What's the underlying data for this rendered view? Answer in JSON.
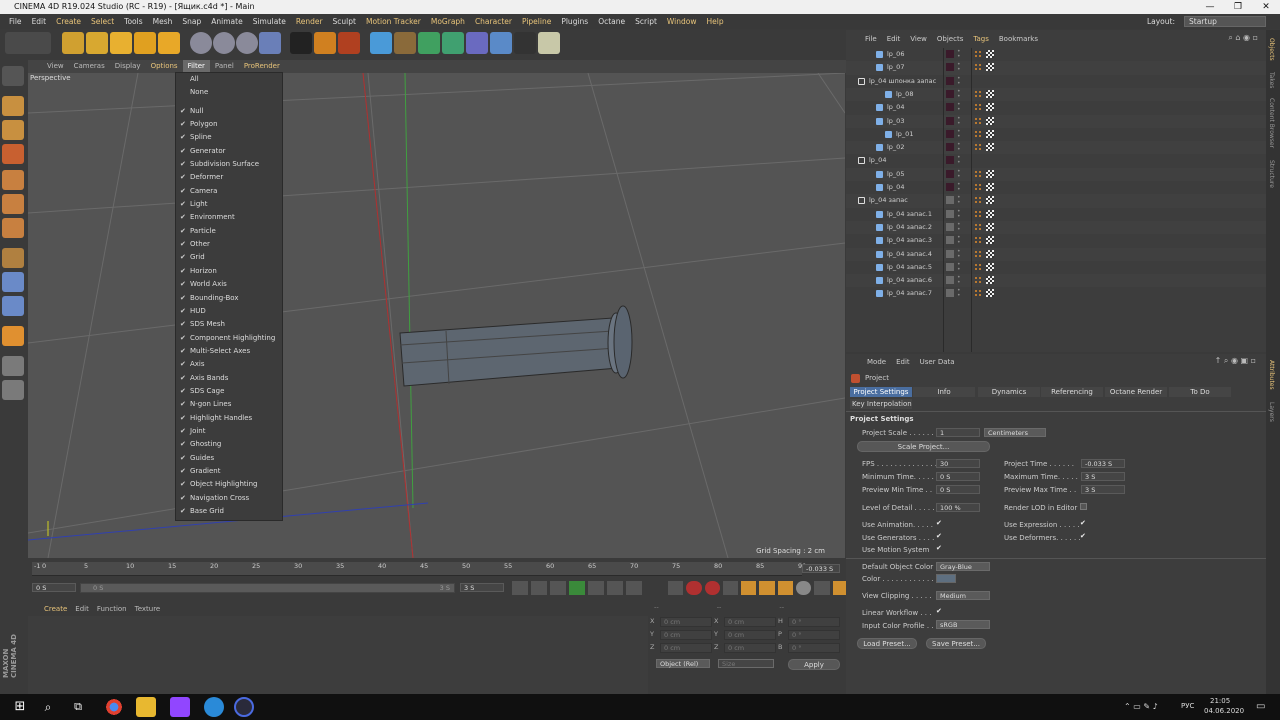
{
  "window": {
    "title": "CINEMA 4D R19.024 Studio (RC - R19) - [Ящик.c4d *] - Main",
    "min": "—",
    "max": "❐",
    "close": "✕"
  },
  "menubar": [
    "File",
    "Edit",
    "Create",
    "Select",
    "Tools",
    "Mesh",
    "Snap",
    "Animate",
    "Simulate",
    "Render",
    "Sculpt",
    "Motion Tracker",
    "MoGraph",
    "Character",
    "Pipeline",
    "Plugins",
    "Octane",
    "Script",
    "Window",
    "Help"
  ],
  "layout": {
    "label": "Layout:",
    "value": "Startup"
  },
  "viewport": {
    "menu": [
      "View",
      "Cameras",
      "Display",
      "Options",
      "Filter",
      "Panel",
      "ProRender"
    ],
    "label": "Perspective",
    "grid_spacing": "Grid Spacing : 2 cm"
  },
  "filter_menu": {
    "top": [
      "All",
      "None"
    ],
    "items": [
      "Null",
      "Polygon",
      "Spline",
      "Generator",
      "Subdivision Surface",
      "Deformer",
      "Camera",
      "Light",
      "Environment",
      "Particle",
      "Other",
      "Grid",
      "Horizon",
      "World Axis",
      "Bounding-Box",
      "HUD",
      "SDS Mesh",
      "Component Highlighting",
      "Multi-Select Axes",
      "Axis",
      "Axis Bands",
      "SDS Cage",
      "N-gon Lines",
      "Highlight Handles",
      "Joint",
      "Ghosting",
      "Guides",
      "Gradient",
      "Object Highlighting",
      "Navigation Cross",
      "Base Grid"
    ]
  },
  "timeline": {
    "ticks": [
      "-1",
      "0",
      "5",
      "10",
      "15",
      "20",
      "25",
      "30",
      "35",
      "40",
      "45",
      "50",
      "55",
      "60",
      "65",
      "70",
      "75",
      "80",
      "85",
      "90"
    ],
    "current": "-0.033 S",
    "start": "0 S",
    "slider_left": "0 S",
    "slider_right": "3 S",
    "end": "3 S"
  },
  "material_menu": [
    "Create",
    "Edit",
    "Function",
    "Texture"
  ],
  "coords": {
    "headers": [
      "--",
      "--",
      "--"
    ],
    "rows": [
      {
        "a": "X",
        "av": "0 cm",
        "b": "X",
        "bv": "0 cm",
        "c": "H",
        "cv": "0 °"
      },
      {
        "a": "Y",
        "av": "0 cm",
        "b": "Y",
        "bv": "0 cm",
        "c": "P",
        "cv": "0 °"
      },
      {
        "a": "Z",
        "av": "0 cm",
        "b": "Z",
        "bv": "0 cm",
        "c": "B",
        "cv": "0 °"
      }
    ],
    "mode": "Object (Rel)",
    "size": "Size",
    "apply": "Apply"
  },
  "object_manager": {
    "menu": [
      "File",
      "Edit",
      "View",
      "Objects",
      "Tags",
      "Bookmarks"
    ],
    "rows": [
      {
        "name": "lp_06",
        "indent": 2
      },
      {
        "name": "lp_07",
        "indent": 2
      },
      {
        "name": "lp_04 шпонка запас",
        "indent": 0
      },
      {
        "name": "lp_08",
        "indent": 3
      },
      {
        "name": "lp_04",
        "indent": 2
      },
      {
        "name": "lp_03",
        "indent": 2
      },
      {
        "name": "lp_01",
        "indent": 3
      },
      {
        "name": "lp_02",
        "indent": 2
      },
      {
        "name": "lp_04",
        "indent": 0
      },
      {
        "name": "lp_05",
        "indent": 2
      },
      {
        "name": "lp_04",
        "indent": 2
      },
      {
        "name": "lp_04 запас",
        "indent": 0
      },
      {
        "name": "lp_04 запас.1",
        "indent": 2
      },
      {
        "name": "lp_04 запас.2",
        "indent": 2
      },
      {
        "name": "lp_04 запас.3",
        "indent": 2
      },
      {
        "name": "lp_04 запас.4",
        "indent": 2
      },
      {
        "name": "lp_04 запас.5",
        "indent": 2
      },
      {
        "name": "lp_04 запас.6",
        "indent": 2
      },
      {
        "name": "lp_04 запас.7",
        "indent": 2
      }
    ]
  },
  "attributes": {
    "menu": [
      "Mode",
      "Edit",
      "User Data"
    ],
    "object": "Project",
    "tabs": [
      "Project Settings",
      "Info",
      "Dynamics",
      "Referencing",
      "Octane Render",
      "To Do"
    ],
    "tab2": "Key Interpolation",
    "section": "Project Settings",
    "scale_label": "Project Scale . . . . . .",
    "scale_value": "1",
    "scale_unit": "Centimeters",
    "scale_button": "Scale Project...",
    "fps_label": "FPS . . . . . . . . . . . . . .",
    "fps": "30",
    "project_time_label": "Project Time . . . . . .",
    "project_time": "-0.033 S",
    "min_time_label": "Minimum Time. . . . .",
    "min_time": "0 S",
    "max_time_label": "Maximum Time. . . . .",
    "max_time": "3 S",
    "prev_min_label": "Preview Min Time . .",
    "prev_min": "0 S",
    "prev_max_label": "Preview Max Time . .",
    "prev_max": "3 S",
    "lod_label": "Level of Detail . . . . .",
    "lod": "100 %",
    "render_lod_label": "Render LOD in Editor",
    "use_animation": "Use Animation. . . . .",
    "use_expression": "Use Expression . . . . .",
    "use_generators": "Use Generators . . . .",
    "use_deformers": "Use Deformers. . . . . .",
    "use_motion": "Use Motion System",
    "default_color_label": "Default Object Color",
    "default_color": "Gray-Blue",
    "color_label": "Color . . . . . . . . . . . .",
    "view_clipping_label": "View Clipping . . . . .",
    "view_clipping": "Medium",
    "linear_workflow": "Linear Workflow . . .",
    "input_profile_label": "Input Color Profile . .",
    "input_profile": "sRGB",
    "load_preset": "Load Preset...",
    "save_preset": "Save Preset..."
  },
  "side_tabs": [
    "Objects",
    "Takes",
    "Content Browser",
    "Structure"
  ],
  "side_tabs_bottom": [
    "Attributes",
    "Layers"
  ],
  "maxon": "MAXON CINEMA 4D",
  "taskbar": {
    "lang": "РУС",
    "time": "21:05",
    "date": "04.06.2020"
  },
  "colors": {
    "accent": "#e8c47a",
    "selection_blue": "#4a6ea0"
  }
}
